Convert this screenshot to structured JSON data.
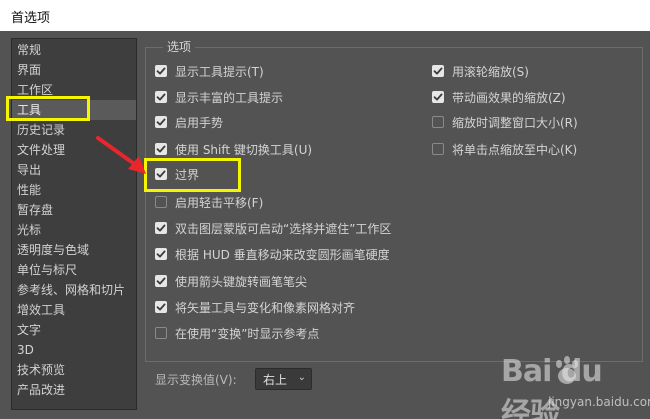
{
  "window": {
    "title": "首选项"
  },
  "sidebar": {
    "items": [
      {
        "label": "常规"
      },
      {
        "label": "界面"
      },
      {
        "label": "工作区"
      },
      {
        "label": "工具"
      },
      {
        "label": "历史记录"
      },
      {
        "label": "文件处理"
      },
      {
        "label": "导出"
      },
      {
        "label": "性能"
      },
      {
        "label": "暂存盘"
      },
      {
        "label": "光标"
      },
      {
        "label": "透明度与色域"
      },
      {
        "label": "单位与标尺"
      },
      {
        "label": "参考线、网格和切片"
      },
      {
        "label": "增效工具"
      },
      {
        "label": "文字"
      },
      {
        "label": "3D"
      },
      {
        "label": "技术预览"
      },
      {
        "label": "产品改进"
      }
    ],
    "selected": "工具"
  },
  "options": {
    "group_title": "选项",
    "left": [
      {
        "label": "显示工具提示(T)",
        "checked": true
      },
      {
        "label": "显示丰富的工具提示",
        "checked": true
      },
      {
        "label": "启用手势",
        "checked": true
      },
      {
        "label": "使用 Shift 键切换工具(U)",
        "checked": true
      },
      {
        "label": "过界",
        "checked": true
      },
      {
        "label": "启用轻击平移(F)",
        "checked": false
      },
      {
        "label": "双击图层蒙版可启动“选择并遮住”工作区",
        "checked": true
      },
      {
        "label": "根据 HUD 垂直移动来改变圆形画笔硬度",
        "checked": true
      },
      {
        "label": "使用箭头键旋转画笔笔尖",
        "checked": true
      },
      {
        "label": "将矢量工具与变化和像素网格对齐",
        "checked": true
      },
      {
        "label": "在使用“变换”时显示参考点",
        "checked": false
      }
    ],
    "right": [
      {
        "label": "用滚轮缩放(S)",
        "checked": true
      },
      {
        "label": "带动画效果的缩放(Z)",
        "checked": true
      },
      {
        "label": "缩放时调整窗口大小(R)",
        "checked": false
      },
      {
        "label": "将单击点缩放至中心(K)",
        "checked": false
      }
    ]
  },
  "transform_value": {
    "label": "显示变换值(V):",
    "selected": "右上"
  },
  "watermark": {
    "text": "Bai du 经验",
    "sub": "jingyan.baidu.com"
  },
  "colors": {
    "highlight": "#f5f500",
    "arrow": "#e8262b",
    "panel_bg": "#535353",
    "sidebar_bg": "#3e3e3e"
  }
}
